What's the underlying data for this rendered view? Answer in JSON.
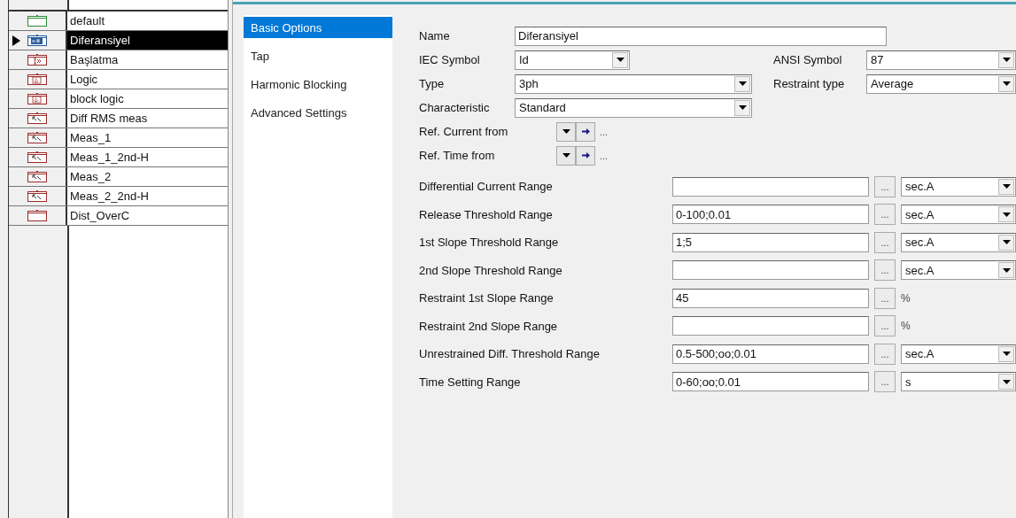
{
  "functions": [
    {
      "name": "default",
      "kind": "main",
      "selected": false
    },
    {
      "name": "Diferansiyel",
      "kind": "diff",
      "selected": true
    },
    {
      "name": "Başlatma",
      "kind": "start",
      "selected": false
    },
    {
      "name": "Logic",
      "kind": "logic",
      "selected": false
    },
    {
      "name": "block logic",
      "kind": "logic",
      "selected": false
    },
    {
      "name": "Diff RMS meas",
      "kind": "meas",
      "selected": false
    },
    {
      "name": "Meas_1",
      "kind": "meas",
      "selected": false
    },
    {
      "name": "Meas_1_2nd-H",
      "kind": "meas",
      "selected": false
    },
    {
      "name": "Meas_2",
      "kind": "meas",
      "selected": false
    },
    {
      "name": "Meas_2_2nd-H",
      "kind": "meas",
      "selected": false
    },
    {
      "name": "Dist_OverC",
      "kind": "frame",
      "selected": false
    }
  ],
  "pages": [
    {
      "label": "Basic Options",
      "selected": true
    },
    {
      "label": "Tap",
      "selected": false
    },
    {
      "label": "Harmonic Blocking",
      "selected": false
    },
    {
      "label": "Advanced Settings",
      "selected": false
    }
  ],
  "form": [
    {
      "kind": "text",
      "label": "Name",
      "value": "Diferansiyel"
    },
    {
      "kind": "combo_pair",
      "label": "IEC Symbol",
      "value": "Id",
      "label2": "ANSI Symbol",
      "value2": "87"
    },
    {
      "kind": "combo_pair_wide",
      "label": "Type",
      "value": "3ph",
      "label2": "Restraint type",
      "value2": "Average"
    },
    {
      "kind": "combo",
      "label": "Characteristic",
      "value": "Standard"
    },
    {
      "kind": "ref",
      "label": "Ref. Current from",
      "more": "..."
    },
    {
      "kind": "ref",
      "label": "Ref. Time from",
      "more": "..."
    }
  ],
  "ranges": [
    {
      "kind": "combo",
      "label": "Differential Current Range",
      "browse": "...",
      "unit": "sec.A"
    },
    {
      "kind": "combo",
      "label": "Release Threshold Range",
      "value": "0-100;0.01",
      "browse": "...",
      "unit": "sec.A"
    },
    {
      "kind": "combo",
      "label": "1st Slope Threshold Range",
      "value": "1;5",
      "browse": "...",
      "unit": "sec.A"
    },
    {
      "kind": "combo",
      "label": "2nd Slope Threshold Range",
      "browse": "...",
      "unit": "sec.A"
    },
    {
      "kind": "plain",
      "label": "Restraint 1st Slope Range",
      "value": "45",
      "browse": "...",
      "unit": "%"
    },
    {
      "kind": "plain",
      "label": "Restraint 2nd Slope Range",
      "browse": "...",
      "unit": "%"
    },
    {
      "kind": "combo",
      "label": "Unrestrained Diff. Threshold Range",
      "value": "0.5-500;oo;0.01",
      "browse": "...",
      "unit": "sec.A"
    },
    {
      "kind": "combo",
      "label": "Time Setting Range",
      "value": "0-60;oo;0.01",
      "browse": "...",
      "unit": "s"
    }
  ]
}
